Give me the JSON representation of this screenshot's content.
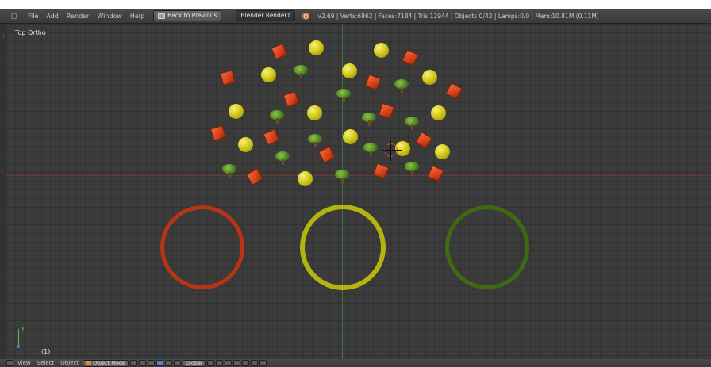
{
  "header": {
    "menus": [
      "File",
      "Add",
      "Render",
      "Window",
      "Help"
    ],
    "back_button": "Back to Previous",
    "render_engine": "Blender Render",
    "stats": "v2.69 | Verts:6862 | Faces:7184 | Tris:12944 | Objects:0/42 | Lamps:0/0 | Mem:10.81M (0.11M)"
  },
  "viewport": {
    "view_label": "Top Ortho",
    "frame_label": "(1)",
    "axis_label_y": "y"
  },
  "footer": {
    "menus": [
      "View",
      "Select",
      "Object"
    ],
    "mode": "Object Mode",
    "orientation": "Global"
  }
}
